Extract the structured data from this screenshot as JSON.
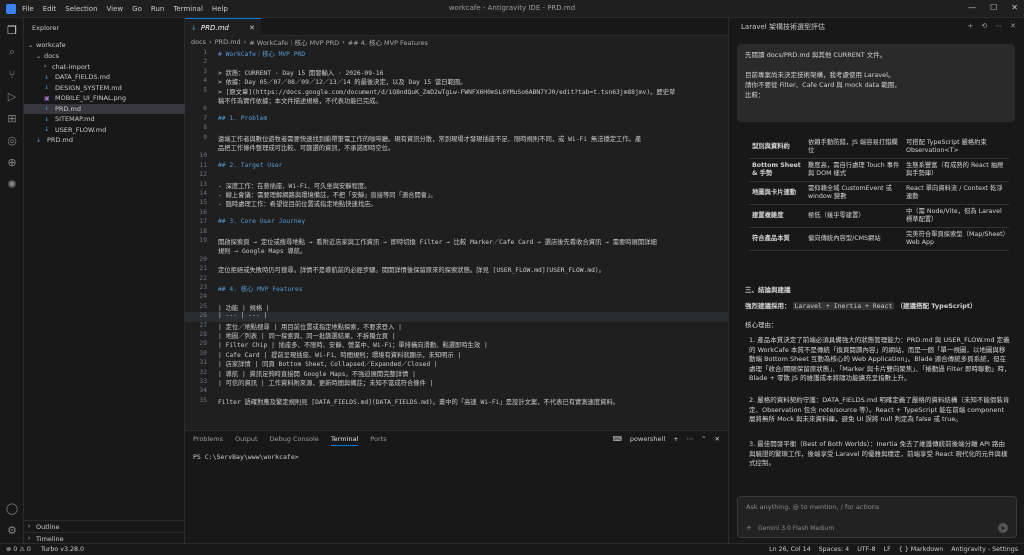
{
  "window": {
    "menu": [
      "File",
      "Edit",
      "Selection",
      "View",
      "Go",
      "Run",
      "Terminal",
      "Help"
    ],
    "title": "workcafe - Antigravity IDE - PRD.md"
  },
  "sidebar": {
    "header": "Explorer",
    "root": "workcafe",
    "items": [
      {
        "label": "docs",
        "type": "folder",
        "depth": 1
      },
      {
        "label": "chat-import",
        "type": "folder",
        "depth": 2
      },
      {
        "label": "DATA_FIELDS.md",
        "type": "md",
        "depth": 2
      },
      {
        "label": "DESIGN_SYSTEM.md",
        "type": "md",
        "depth": 2
      },
      {
        "label": "MOBILE_UI_FINAL.png",
        "type": "img",
        "depth": 2
      },
      {
        "label": "PRD.md",
        "type": "md",
        "depth": 2
      },
      {
        "label": "SITEMAP.md",
        "type": "md",
        "depth": 2
      },
      {
        "label": "USER_FLOW.md",
        "type": "md",
        "depth": 2
      },
      {
        "label": "PRD.md",
        "type": "md",
        "depth": 1
      }
    ],
    "outline": "Outline",
    "timeline": "Timeline"
  },
  "editor": {
    "tab": "PRD.md",
    "breadcrumb": [
      "docs",
      "PRD.md",
      "# WorkCafe｜核心 MVP PRD",
      "## 4. 核心 MVP Features"
    ],
    "lines": [
      {
        "n": "1",
        "t": "# WorkCafe｜核心 MVP PRD",
        "h": true
      },
      {
        "n": "2",
        "t": ""
      },
      {
        "n": "3",
        "t": "> 狀態：CURRENT · Day 15 開發輸入 · 2026-09-16"
      },
      {
        "n": "4",
        "t": "> 依據：Day 05／07／08／09／12／13／14 的最後決定，以及 Day 15 當日範圍。"
      },
      {
        "n": "5",
        "t": "> [原文章](https://docs.google.com/document/d/1Q8ndQuK_ZmD2wTgLw-FWNFX6H0mSL6YMuSo6ABN7YJ0/edit?tab=t.tsn63jm88jmv)。歷史草"
      },
      {
        "n": "",
        "t": "稿不作為實作依據；本文件描述規格，不代表功能已完成。"
      },
      {
        "n": "6",
        "t": ""
      },
      {
        "n": "7",
        "t": "## 1. Problem",
        "h": true
      },
      {
        "n": "8",
        "t": ""
      },
      {
        "n": "9",
        "t": "遠端工作者與數位遊牧者需要快速找到能帶筆電工作的咖啡廳。現有資訊分散，常到現場才發現插座不足、限時規則不同，或 Wi-Fi 無法穩定工作。產"
      },
      {
        "n": "",
        "t": "品把工作條件整理成可比較、可篩選的資訊，不承諾即時空位。"
      },
      {
        "n": "10",
        "t": ""
      },
      {
        "n": "11",
        "t": "## 2. Target User",
        "h": true
      },
      {
        "n": "12",
        "t": ""
      },
      {
        "n": "13",
        "t": "- 深度工作：在意插座、Wi-Fi、可久坐與安靜程度。"
      },
      {
        "n": "14",
        "t": "- 線上會議：需要理解網路與環境備註，不把「安靜」直接等同「適合開會」。"
      },
      {
        "n": "15",
        "t": "- 臨時處理工作：希望從目前位置或指定地點快速找店。"
      },
      {
        "n": "16",
        "t": ""
      },
      {
        "n": "17",
        "t": "## 3. Core User Journey",
        "h": true
      },
      {
        "n": "18",
        "t": ""
      },
      {
        "n": "19",
        "t": "開啟探索頁 → 定位或搜尋地點 → 看附近店家與工作資訊 → 即時切換 Filter → 比較 Marker／Cafe Card → 選店後先看收合資訊 → 需要時展開詳細"
      },
      {
        "n": "",
        "t": "規則 → Google Maps 導航。"
      },
      {
        "n": "20",
        "t": ""
      },
      {
        "n": "21",
        "t": "定位拒絕或失敗時仍可搜尋。詳情不是導航前的必經步驟。閱開詳情後保留原來的探索狀態。詳見 [USER_FLOW.md](USER_FLOW.md)。"
      },
      {
        "n": "22",
        "t": ""
      },
      {
        "n": "23",
        "t": "## 4. 核心 MVP Features",
        "h": true
      },
      {
        "n": "24",
        "t": ""
      },
      {
        "n": "25",
        "t": "| 功能 | 規格 |"
      },
      {
        "n": "26",
        "t": "| --- | --- |",
        "cur": true
      },
      {
        "n": "27",
        "t": "| 定位／地點搜尋 | 用目前位置或指定地點探索，不要求登入 |"
      },
      {
        "n": "28",
        "t": "| 地圖／列表 | 同一探索頁、同一批篩選結果，不拆獨立頁 |"
      },
      {
        "n": "29",
        "t": "| Filter Chip | 插座多、不限時、安靜、營業中、Wi-Fi；單排橫向滑動、點選即時生效 |"
      },
      {
        "n": "30",
        "t": "| Cafe Card | 提前呈現插座、Wi-Fi、時間規則；環境有資料就顯示，未知明示 |"
      },
      {
        "n": "31",
        "t": "| 店家詳情 | 同頁 Bottom Sheet，Collapsed／Expanded／Closed |"
      },
      {
        "n": "32",
        "t": "| 導航 | 資訊足夠時直接開 Google Maps，不強迫展開完整詳情 |"
      },
      {
        "n": "33",
        "t": "| 可信的資訊 | 工作資料附來源、更新時間與備註；未知不當成符合條件 |"
      },
      {
        "n": "34",
        "t": ""
      },
      {
        "n": "35",
        "t": "Filter 語確對應及繁定規則見 [DATA_FIELDS.md](DATA_FIELDS.md)。畫中的「高速 Wi-Fi」是設計文案，不代表已有實測速度資料。"
      }
    ]
  },
  "panel": {
    "tabs": [
      "Problems",
      "Output",
      "Debug Console",
      "Terminal",
      "Ports"
    ],
    "active": "Terminal",
    "shell": "powershell",
    "prompt": "PS C:\\ServBay\\www\\workcafe>"
  },
  "agent": {
    "title": "Laravel 架構技術選型評估",
    "bubble": [
      "先閱讀 docs/PRD.md 與其他 CURRENT 文件。",
      "",
      "目前專案尚未決定技術架構，我考慮使用 Laravel。",
      "請你不要從 Filter、Cafe Card 與 mock data 範圍，",
      "比較："
    ],
    "table": [
      [
        "型別與資料約",
        "依賴手動防錯，JS 端容易打錯欄位",
        "可搭配 TypeScript 嚴格約束 Observation<T>"
      ],
      [
        "Bottom Sheet & 手勢",
        "難度高，需自行處理 Touch 事件與 DOM 樣式",
        "生態系豐富（有成熟的 React 抽屜與手勢庫）"
      ],
      [
        "地圖與卡片連動",
        "需仰賴全域 CustomEvent 或 window 變數",
        "React 單向資料流 / Context 乾淨連動"
      ],
      [
        "建置複雜度",
        "極低（幾乎零建置）",
        "中（需 Node/Vite，但為 Laravel 標準配置）"
      ],
      [
        "符合產品本質",
        "偏向傳統內容型/CMS網站",
        "完美符合單頁探索型（Map/Sheet）Web App"
      ]
    ],
    "section": "三、結論與建議",
    "recommend_prefix": "強烈建議採用：",
    "recommend_code": "Laravel + Inertia + React",
    "recommend_suffix": "（建議搭配 TypeScript）",
    "reason_head": "核心理由：",
    "reasons": [
      "1. 產品本質決定了前端必須具備強大的狀態管理能力：PRD.md 與 USER_FLOW.md 定義的 WorkCafe 本質不是傳統「換頁閱讀內容」的網站，而是一個「單一視圖，以地圖與移動端 Bottom Sheet 互動為核心的 Web Application」。Blade 適合傳統多頁系統，但在處理「收合/關閉保留原狀態」、「Marker 與卡片雙向聚焦」、「捲動過 Filter 即時聯動」時，Blade + 零散 JS 的維護成本將隨功能擴充呈指數上升。",
      "2. 嚴格的資料契約守護：DATA_FIELDS.md 明確定義了嚴格的資料結構（未知不能假裝肯定、Observation 包含 note/source 等）。React + TypeScript 能在前端 component 層將無所 Mock 與未來資料庫，避免 UI 誤將 null 判定為 false 或 true。",
      "3. 最佳開發平衡（Best of Both Worlds）：Inertia 免去了維護傳統前後端分離 API 路由與驗證的繁瑣工作，後端享受 Laravel 的優雅與穩定，前端享受 React 現代化的元件與樣式控制。"
    ],
    "ask_placeholder": "Ask anything, @ to mention, / for actions",
    "model": "Gemini 3.0 Flash Medium"
  },
  "status": {
    "left": [
      "⊗ 0 ⚠ 0",
      "Turbo v3.28.0"
    ],
    "right": [
      "Ln 26, Col 14",
      "Spaces: 4",
      "UTF-8",
      "LF",
      "{ } Markdown",
      "Antigravity - Settings"
    ]
  }
}
